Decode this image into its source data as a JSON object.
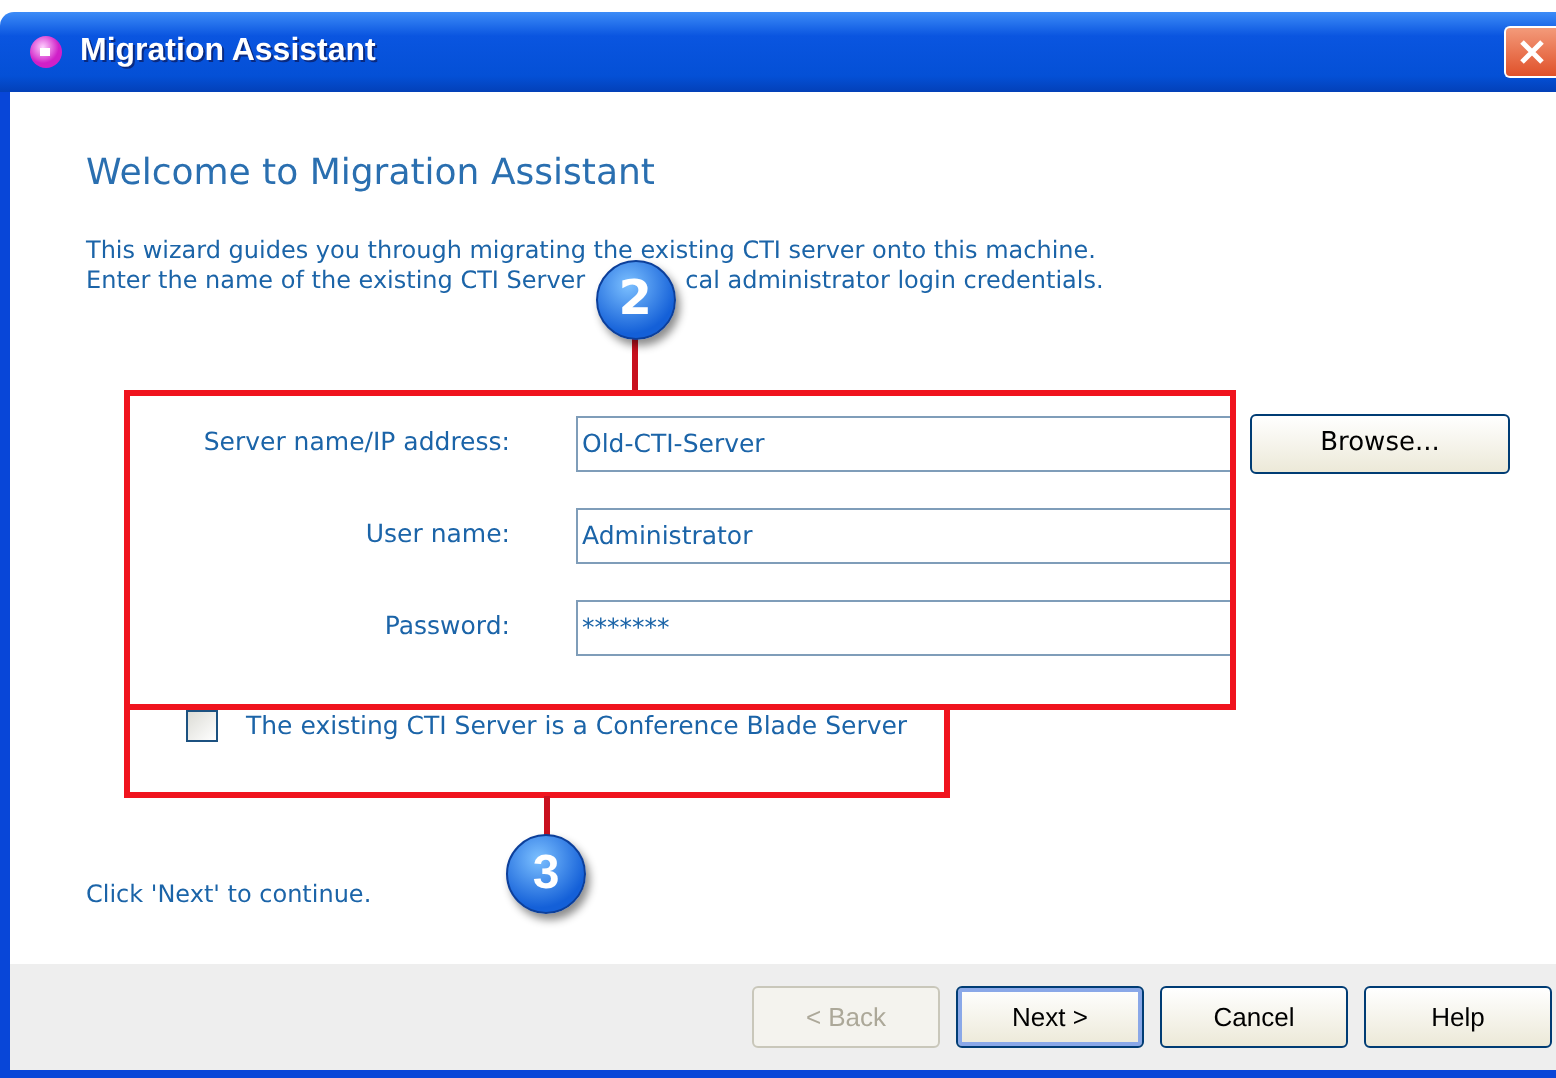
{
  "window": {
    "title": "Migration Assistant"
  },
  "heading": "Welcome to Migration Assistant",
  "intro_line_1": "This wizard guides you through migrating the existing CTI server onto this machine.",
  "intro_line_2_parts": [
    "Enter the name of the existing CTI Server",
    "cal administrator login credentials."
  ],
  "fields": [
    {
      "label": "Server name/IP address:",
      "value": "Old-CTI-Server"
    },
    {
      "label": "User name:",
      "value": "Administrator"
    },
    {
      "label": "Password:",
      "value": "*******"
    }
  ],
  "browse_button": "Browse...",
  "checkbox": {
    "label": "The existing CTI Server is a Conference Blade Server",
    "checked": false
  },
  "callouts": [
    {
      "number": "2"
    },
    {
      "number": "3"
    }
  ],
  "footer_text": "Click 'Next' to continue.",
  "buttons": [
    {
      "label": "< Back",
      "disabled": true,
      "default": false
    },
    {
      "label": "Next >",
      "disabled": false,
      "default": true
    },
    {
      "label": "Cancel",
      "disabled": false,
      "default": false
    },
    {
      "label": "Help",
      "disabled": false,
      "default": false
    }
  ]
}
